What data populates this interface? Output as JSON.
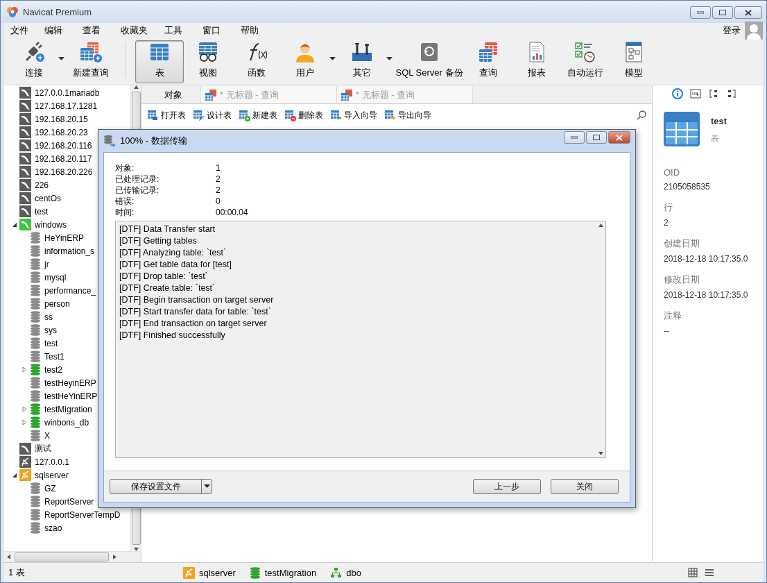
{
  "window": {
    "title": "Navicat Premium"
  },
  "menu": [
    {
      "label": "文件"
    },
    {
      "label": "编辑"
    },
    {
      "label": "查看"
    },
    {
      "label": "收藏夹"
    },
    {
      "label": "工具"
    },
    {
      "label": "窗口"
    },
    {
      "label": "帮助"
    }
  ],
  "login": {
    "label": "登录"
  },
  "toolbar": [
    {
      "kind": "connect",
      "label": "连接",
      "selected": false,
      "dropdown": true
    },
    {
      "kind": "new-query",
      "label": "新建查询",
      "selected": false,
      "dropdown": false
    },
    {
      "kind": "table",
      "label": "表",
      "selected": true,
      "dropdown": false
    },
    {
      "kind": "view",
      "label": "视图",
      "selected": false,
      "dropdown": false
    },
    {
      "kind": "function",
      "label": "函数",
      "selected": false,
      "dropdown": false
    },
    {
      "kind": "user",
      "label": "用户",
      "selected": false,
      "dropdown": true
    },
    {
      "kind": "other",
      "label": "其它",
      "selected": false,
      "dropdown": true
    },
    {
      "kind": "backup",
      "label": "SQL Server 备份",
      "selected": false,
      "dropdown": false
    },
    {
      "kind": "query",
      "label": "查询",
      "selected": false,
      "dropdown": false
    },
    {
      "kind": "report",
      "label": "报表",
      "selected": false,
      "dropdown": false
    },
    {
      "kind": "schedule",
      "label": "自动运行",
      "selected": false,
      "dropdown": false
    },
    {
      "kind": "model",
      "label": "模型",
      "selected": false,
      "dropdown": false
    }
  ],
  "tree": [
    {
      "label": "127.0.0.1mariadb",
      "kind": "mysql",
      "connected": false,
      "expandable": false
    },
    {
      "label": "127.168.17.1281",
      "kind": "mysql",
      "connected": false,
      "expandable": false
    },
    {
      "label": "192.168.20.15",
      "kind": "mysql",
      "connected": false,
      "expandable": false
    },
    {
      "label": "192.168.20.23",
      "kind": "mysql",
      "connected": false,
      "expandable": false
    },
    {
      "label": "192.168.20.116",
      "kind": "mysql",
      "connected": false,
      "expandable": false
    },
    {
      "label": "192.168.20.117",
      "kind": "mysql",
      "connected": false,
      "expandable": false
    },
    {
      "label": "192.168.20.226",
      "kind": "mysql",
      "connected": false,
      "expandable": false
    },
    {
      "label": "226",
      "kind": "mysql",
      "connected": false,
      "expandable": false
    },
    {
      "label": "centOs",
      "kind": "mysql",
      "connected": false,
      "expandable": false
    },
    {
      "label": "test",
      "kind": "mysql",
      "connected": false,
      "expandable": false
    },
    {
      "label": "windows",
      "kind": "mysql",
      "connected": true,
      "expandable": true,
      "expanded": true,
      "children": [
        {
          "label": "HeYinERP",
          "kind": "database",
          "connected": false,
          "expandable": false
        },
        {
          "label": "information_s",
          "kind": "database",
          "connected": false,
          "expandable": false
        },
        {
          "label": "jr",
          "kind": "database",
          "connected": false,
          "expandable": false
        },
        {
          "label": "mysql",
          "kind": "database",
          "connected": false,
          "expandable": false
        },
        {
          "label": "performance_",
          "kind": "database",
          "connected": false,
          "expandable": false
        },
        {
          "label": "person",
          "kind": "database",
          "connected": false,
          "expandable": false
        },
        {
          "label": "ss",
          "kind": "database",
          "connected": false,
          "expandable": false
        },
        {
          "label": "sys",
          "kind": "database",
          "connected": false,
          "expandable": false
        },
        {
          "label": "test",
          "kind": "database",
          "connected": false,
          "expandable": false
        },
        {
          "label": "Test1",
          "kind": "database",
          "connected": false,
          "expandable": false
        },
        {
          "label": "test2",
          "kind": "database",
          "connected": true,
          "expandable": true,
          "expanded": false
        },
        {
          "label": "testHeyinERP",
          "kind": "database",
          "connected": false,
          "expandable": false
        },
        {
          "label": "testHeYinERP",
          "kind": "database",
          "connected": false,
          "expandable": false
        },
        {
          "label": "testMigration",
          "kind": "database",
          "connected": true,
          "expandable": true,
          "expanded": false
        },
        {
          "label": "winbons_db",
          "kind": "database",
          "connected": true,
          "expandable": true,
          "expanded": false
        },
        {
          "label": "X",
          "kind": "database",
          "connected": false,
          "expandable": false
        }
      ]
    },
    {
      "label": "测试",
      "kind": "mysql",
      "connected": false,
      "expandable": false
    },
    {
      "label": "127.0.0.1",
      "kind": "sqlserver",
      "connected": false,
      "expandable": false
    },
    {
      "label": "sqlserver",
      "kind": "sqlserver",
      "connected": true,
      "expandable": true,
      "expanded": true,
      "children": [
        {
          "label": "GZ",
          "kind": "database",
          "connected": false,
          "expandable": false
        },
        {
          "label": "ReportServer",
          "kind": "database",
          "connected": false,
          "expandable": false
        },
        {
          "label": "ReportServerTempD",
          "kind": "database",
          "connected": false,
          "expandable": false
        },
        {
          "label": "szao",
          "kind": "database",
          "connected": false,
          "expandable": false
        }
      ]
    }
  ],
  "tabs": [
    {
      "label": "对象",
      "kind": "objects",
      "selected": true
    },
    {
      "label": "* 无标题 - 查询",
      "kind": "query",
      "selected": false
    },
    {
      "label": "* 无标题 - 查询",
      "kind": "query",
      "selected": false
    }
  ],
  "object_toolbar": [
    {
      "kind": "open",
      "label": "打开表"
    },
    {
      "kind": "design",
      "label": "设计表"
    },
    {
      "kind": "new",
      "label": "新建表"
    },
    {
      "kind": "delete",
      "label": "删除表"
    },
    {
      "kind": "import",
      "label": "导入向导"
    },
    {
      "kind": "export",
      "label": "导出向导"
    }
  ],
  "info_panel": {
    "tabs": [
      {
        "kind": "info",
        "selected": true
      },
      {
        "kind": "ddl",
        "selected": false
      },
      {
        "kind": "deps",
        "selected": false
      },
      {
        "kind": "refs",
        "selected": false
      }
    ],
    "title": "test",
    "subtitle": "表",
    "fields": [
      {
        "label": "OID",
        "value": "2105058535"
      },
      {
        "label": "行",
        "value": "2"
      },
      {
        "label": "创建日期",
        "value": "2018-12-18 10:17:35.0"
      },
      {
        "label": "修改日期",
        "value": "2018-12-18 10:17:35.0"
      },
      {
        "label": "注释",
        "value": "--"
      }
    ]
  },
  "dialog": {
    "title": "100% - 数据传输",
    "stats": [
      {
        "label": "对象:",
        "value": "1"
      },
      {
        "label": "已处理记录:",
        "value": "2"
      },
      {
        "label": "已传输记录:",
        "value": "2"
      },
      {
        "label": "错误:",
        "value": "0"
      },
      {
        "label": "时间:",
        "value": "00:00.04"
      }
    ],
    "log": [
      "[DTF] Data Transfer start",
      "[DTF] Getting tables",
      "[DTF] Analyzing table: `test`",
      "[DTF] Get table data for [test]",
      "[DTF] Drop table: `test`",
      "[DTF] Create table: `test`",
      "[DTF] Begin transaction on target server",
      "[DTF] Start transfer data for table: `test`",
      "[DTF] End transaction on target server",
      "[DTF] Finished successfully"
    ],
    "save_button": "保存设置文件",
    "buttons": [
      "上一步",
      "关闭"
    ]
  },
  "status_bar": {
    "count": "1 表",
    "items": [
      {
        "kind": "server",
        "label": "sqlserver"
      },
      {
        "kind": "database",
        "label": "testMigration"
      },
      {
        "kind": "schema",
        "label": "dbo"
      }
    ]
  }
}
